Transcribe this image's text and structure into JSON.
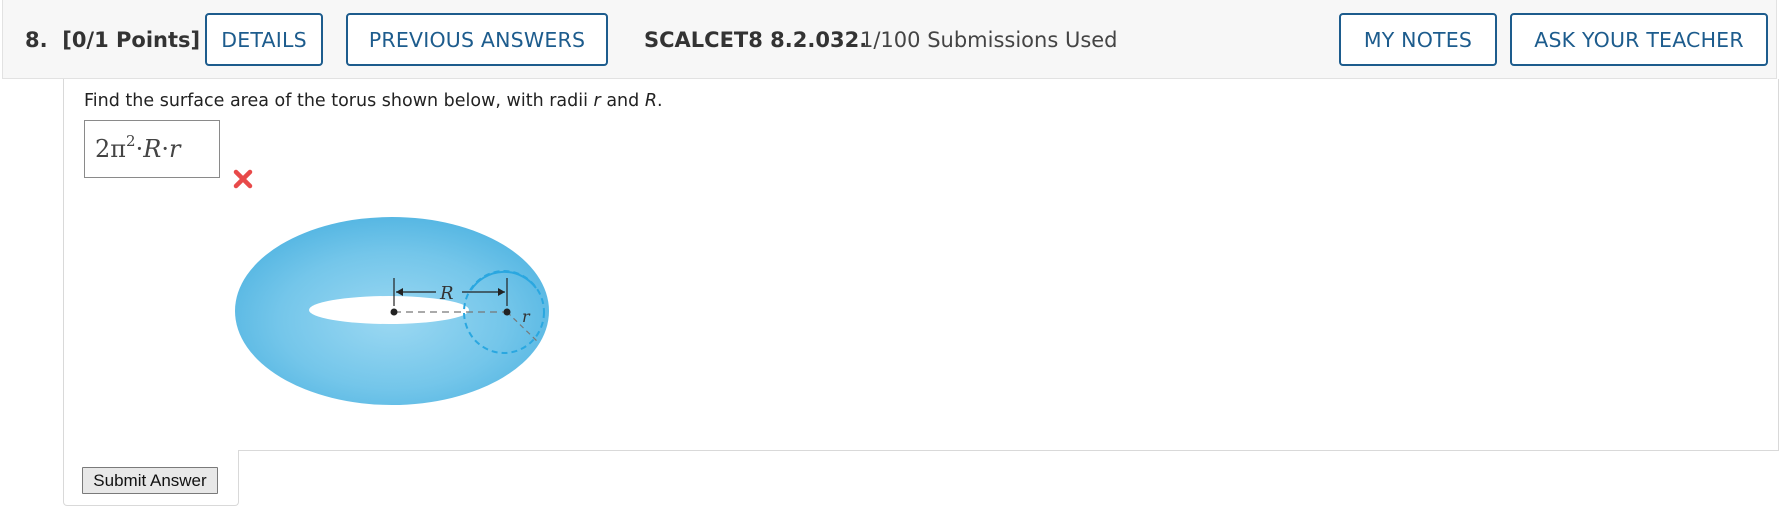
{
  "header": {
    "question_number": "8.",
    "points": "[0/1 Points]",
    "details_label": "DETAILS",
    "previous_answers_label": "PREVIOUS ANSWERS",
    "reference": "SCALCET8 8.2.032.",
    "submissions": "1/100 Submissions Used",
    "my_notes_label": "MY NOTES",
    "ask_teacher_label": "ASK YOUR TEACHER"
  },
  "question": {
    "prompt_text_1": "Find the surface area of the torus shown below, with radii ",
    "var_r": "r",
    "prompt_and": " and ",
    "var_R": "R",
    "prompt_end": ".",
    "answer_value": "2π²·R·r",
    "answer_status": "incorrect",
    "answer_status_icon": "close-icon",
    "figure": {
      "label_R": "R",
      "label_r": "r"
    }
  },
  "submit_label": "Submit Answer",
  "colors": {
    "button_blue": "#1d5c8d",
    "torus_blue": "#6ec6ea",
    "wrong_red": "#e84a4a"
  }
}
